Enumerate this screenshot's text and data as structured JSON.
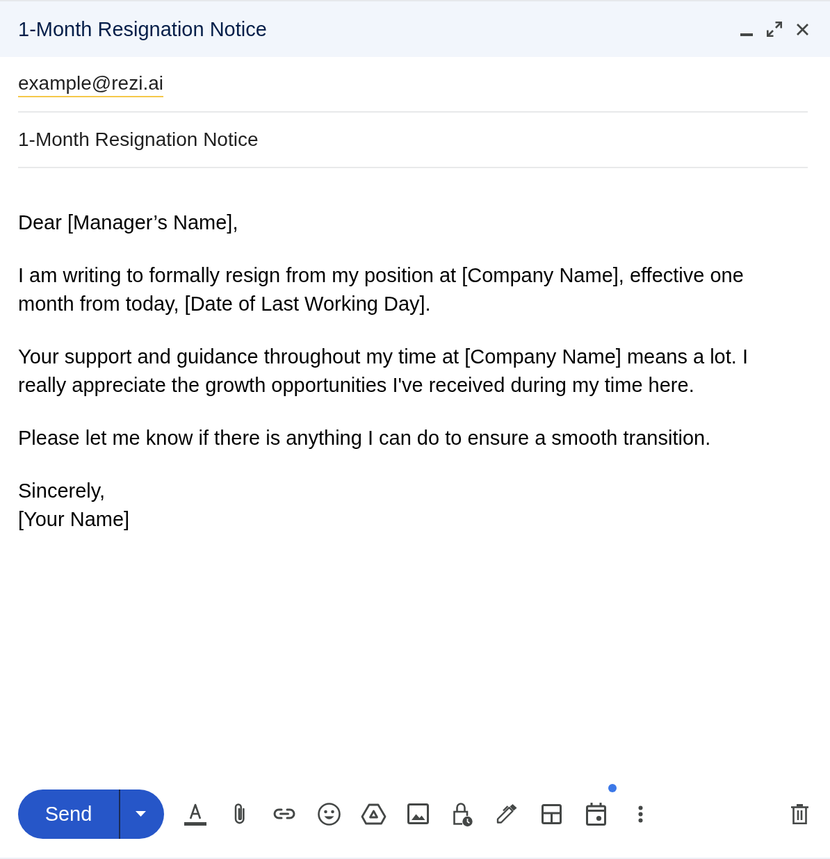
{
  "window": {
    "title": "1-Month Resignation Notice",
    "controls": [
      {
        "kind": "minimize"
      },
      {
        "kind": "expand"
      },
      {
        "kind": "close"
      }
    ]
  },
  "recipients": {
    "value": "example@rezi.ai"
  },
  "subject": {
    "value": "1-Month Resignation Notice"
  },
  "body": {
    "paragraphs": [
      "Dear [Manager’s Name],",
      "I am writing to formally resign from my position at [Company Name], effective one month from today, [Date of Last Working Day].",
      "Your support and guidance throughout my time at [Company Name] means a lot. I really appreciate the growth opportunities I've received during my time here.",
      "Please let me know if there is anything I can do to ensure a smooth transition."
    ],
    "sign_off": {
      "valediction": "Sincerely,",
      "name": "[Your Name]"
    }
  },
  "toolbar": {
    "send": {
      "label": "Send"
    },
    "tools": [
      {
        "kind": "format",
        "badge": false
      },
      {
        "kind": "attach",
        "badge": false
      },
      {
        "kind": "link",
        "badge": false
      },
      {
        "kind": "emoji",
        "badge": false
      },
      {
        "kind": "drive",
        "badge": false
      },
      {
        "kind": "photo",
        "badge": false
      },
      {
        "kind": "confidential",
        "badge": false
      },
      {
        "kind": "signature",
        "badge": false
      },
      {
        "kind": "layout",
        "badge": false
      },
      {
        "kind": "schedule",
        "badge": true
      },
      {
        "kind": "more",
        "badge": false
      }
    ],
    "trailing": [
      {
        "kind": "discard"
      }
    ]
  }
}
